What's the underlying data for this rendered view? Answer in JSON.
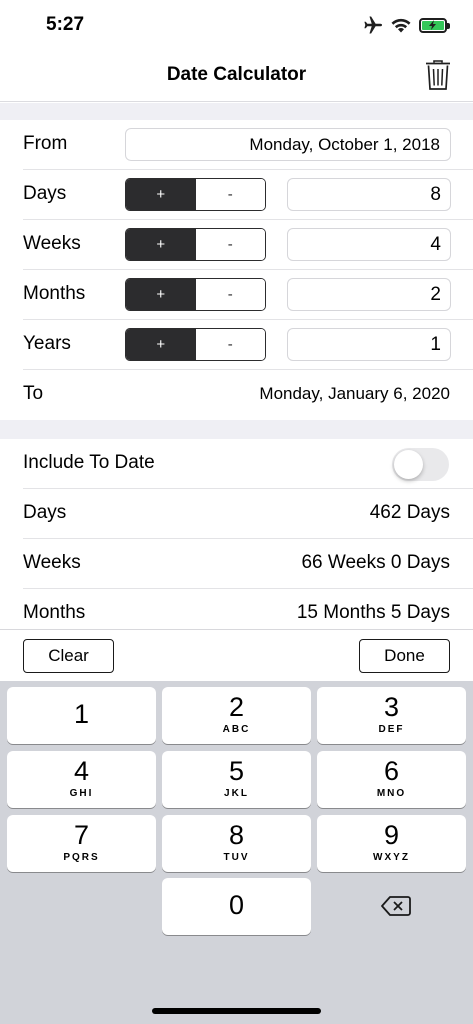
{
  "status_bar": {
    "time": "5:27",
    "icons": [
      "airplane-icon",
      "wifi-icon",
      "battery-charging-icon"
    ]
  },
  "nav": {
    "title": "Date Calculator",
    "trash_icon": "trash-icon"
  },
  "from": {
    "label": "From",
    "value": "Monday, October 1, 2018"
  },
  "offsets": [
    {
      "label": "Days",
      "plus": "+",
      "minus": "-",
      "value": "8"
    },
    {
      "label": "Weeks",
      "plus": "+",
      "minus": "-",
      "value": "4"
    },
    {
      "label": "Months",
      "plus": "+",
      "minus": "-",
      "value": "2"
    },
    {
      "label": "Years",
      "plus": "+",
      "minus": "-",
      "value": "1"
    }
  ],
  "to": {
    "label": "To",
    "value": "Monday, January 6, 2020"
  },
  "include_to_date": {
    "label": "Include To Date",
    "enabled": false
  },
  "results": [
    {
      "label": "Days",
      "value": "462 Days"
    },
    {
      "label": "Weeks",
      "value": "66 Weeks 0 Days"
    },
    {
      "label": "Months",
      "value": "15 Months 5 Days"
    }
  ],
  "toolbar": {
    "clear_label": "Clear",
    "done_label": "Done"
  },
  "keypad": {
    "keys": [
      {
        "num": "1",
        "letters": ""
      },
      {
        "num": "2",
        "letters": "ABC"
      },
      {
        "num": "3",
        "letters": "DEF"
      },
      {
        "num": "4",
        "letters": "GHI"
      },
      {
        "num": "5",
        "letters": "JKL"
      },
      {
        "num": "6",
        "letters": "MNO"
      },
      {
        "num": "7",
        "letters": "PQRS"
      },
      {
        "num": "8",
        "letters": "TUV"
      },
      {
        "num": "9",
        "letters": "WXYZ"
      },
      {
        "num": "0",
        "letters": ""
      }
    ],
    "delete_icon": "delete-backspace-icon"
  },
  "colors": {
    "segment_active": "#2c2c2e",
    "battery": "#34c759",
    "group_background": "#efeff4",
    "keyboard_background": "#d1d3d9"
  }
}
